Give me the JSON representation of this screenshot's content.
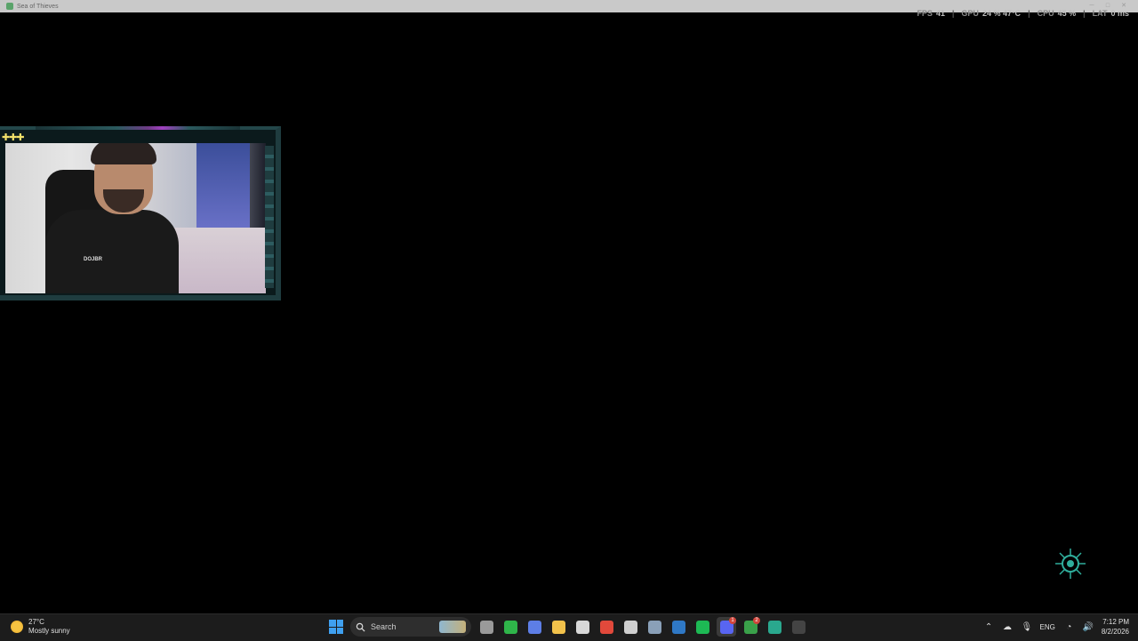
{
  "window": {
    "title": "Sea of Thieves"
  },
  "perf": {
    "fps_label": "FPS",
    "fps_value": "41",
    "gpu_label": "GPU",
    "gpu_value": "24 % 47°C",
    "cpu_label": "CPU",
    "cpu_value": "45 %",
    "lat_label": "LAT",
    "lat_value": "0 ms"
  },
  "webcam": {
    "shirt_text": "DOJBR"
  },
  "taskbar": {
    "weather": {
      "temperature": "27°C",
      "condition": "Mostly sunny"
    },
    "search": {
      "placeholder": "Search"
    },
    "apps": [
      {
        "name": "Task View",
        "color": "#9a9a9a",
        "glyph": ""
      },
      {
        "name": "WhatsApp",
        "color": "#2fb54a",
        "glyph": ""
      },
      {
        "name": "Copilot",
        "color": "#5d7ee6",
        "glyph": ""
      },
      {
        "name": "File Explorer",
        "color": "#f2c24b",
        "glyph": ""
      },
      {
        "name": "Microsoft Store",
        "color": "#d8d8d8",
        "glyph": ""
      },
      {
        "name": "Chrome",
        "color": "#e2493b",
        "glyph": ""
      },
      {
        "name": "ChatGPT",
        "color": "#cfcfcf",
        "glyph": ""
      },
      {
        "name": "Settings",
        "color": "#8aa0b8",
        "glyph": ""
      },
      {
        "name": "Remote Desktop",
        "color": "#2f78c5",
        "glyph": ""
      },
      {
        "name": "Spotify",
        "color": "#1db954",
        "glyph": ""
      },
      {
        "name": "Discord",
        "color": "#5865f2",
        "glyph": "",
        "badge": "1"
      },
      {
        "name": "Xbox",
        "color": "#3aa14a",
        "glyph": "",
        "badge": "2"
      },
      {
        "name": "Notes",
        "color": "#2aa88e",
        "glyph": ""
      },
      {
        "name": "Sea of Thieves",
        "color": "#444444",
        "glyph": ""
      }
    ],
    "tray": {
      "language": "ENG",
      "time": "7:12 PM",
      "date": "8/2/2026"
    }
  }
}
